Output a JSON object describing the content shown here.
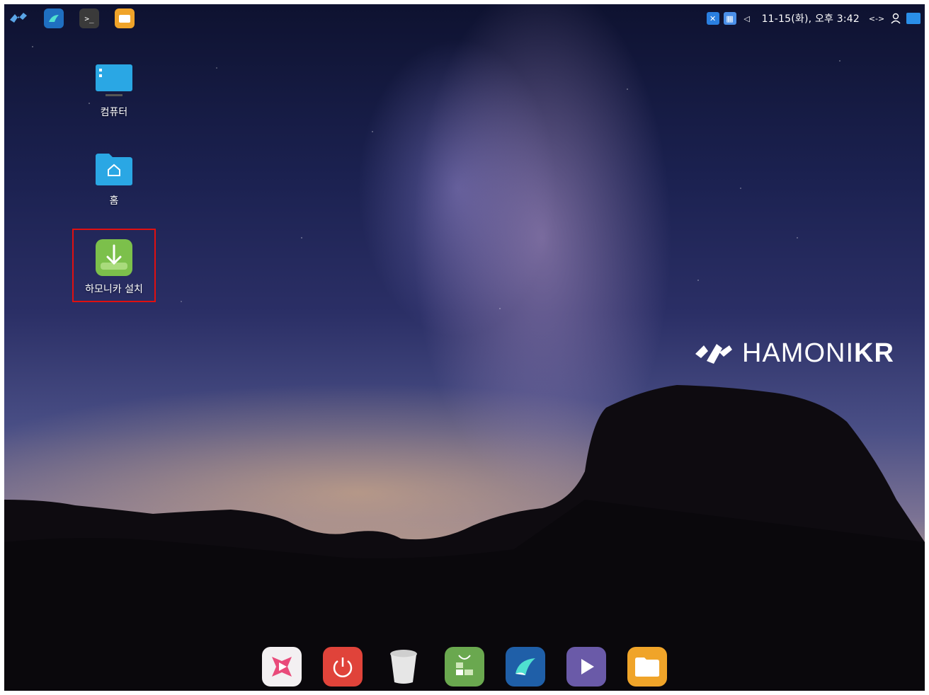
{
  "top_panel": {
    "launchers": [
      {
        "icon": "hamonikr-menu-icon"
      },
      {
        "icon": "browser-icon"
      },
      {
        "icon": "terminal-icon"
      },
      {
        "icon": "files-icon"
      }
    ],
    "tray": {
      "icons": [
        "network-icon",
        "keyboard-icon",
        "volume-icon"
      ],
      "clock": "11-15(화), 오후 3:42",
      "extra_icons": [
        "connection-arrows-icon",
        "user-icon",
        "show-desktop-icon"
      ]
    }
  },
  "desktop": {
    "icons": [
      {
        "label": "컴퓨터",
        "icon": "computer-icon"
      },
      {
        "label": "홈",
        "icon": "home-folder-icon"
      },
      {
        "label": "하모니카 설치",
        "icon": "install-download-icon",
        "highlighted": true
      }
    ]
  },
  "brand": {
    "text_light": "HAMONI",
    "text_bold": "KR"
  },
  "dock": {
    "items": [
      {
        "icon": "media-player-icon",
        "color": "#f3f0f2"
      },
      {
        "icon": "power-icon",
        "color": "#e0433a"
      },
      {
        "icon": "trash-icon",
        "color": "#d8d8d8"
      },
      {
        "icon": "software-center-icon",
        "color": "#6aa84f"
      },
      {
        "icon": "browser-icon",
        "color": "#1f5fa8"
      },
      {
        "icon": "video-player-icon",
        "color": "#6a5aa8"
      },
      {
        "icon": "files-icon",
        "color": "#f0a429"
      }
    ]
  },
  "colors": {
    "highlight_box": "#e01010",
    "install_icon_green": "#7cc04b",
    "folder_blue": "#2aa7e4"
  }
}
